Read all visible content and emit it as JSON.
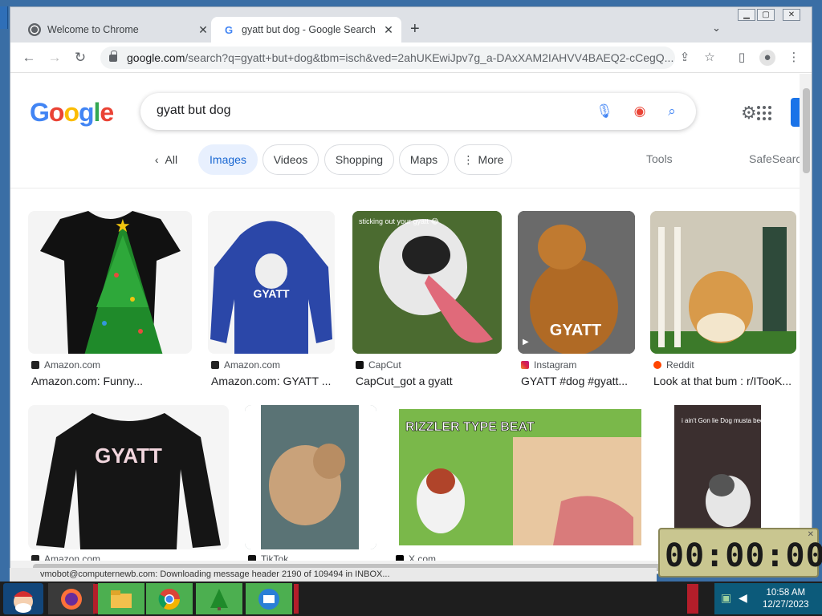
{
  "browser": {
    "tabs": [
      {
        "title": "Welcome to Chrome",
        "active": false
      },
      {
        "title": "gyatt but dog - Google Search",
        "active": true
      }
    ],
    "url_host": "google.com",
    "url_path": "/search?q=gyatt+but+dog&tbm=isch&ved=2ahUKEwiJpv7g_a-DAxXAM2IAHVV4BAEQ2-cCegQ..."
  },
  "google": {
    "logo": "Google",
    "query": "gyatt but dog",
    "chips": [
      "All",
      "Images",
      "Videos",
      "Shopping",
      "Maps",
      "More"
    ],
    "tools": "Tools",
    "safesearch": "SafeSearch"
  },
  "results": [
    {
      "source": "Amazon.com",
      "caption": "Amazon.com: Funny...",
      "thumb_text": ""
    },
    {
      "source": "Amazon.com",
      "caption": "Amazon.com: GYATT ...",
      "thumb_text": "GYATT"
    },
    {
      "source": "CapCut",
      "caption": "CapCut_got a gyatt",
      "thumb_text": "sticking out your gyatt 😂"
    },
    {
      "source": "Instagram",
      "caption": "GYATT #dog #gyatt...",
      "thumb_text": "GYATT"
    },
    {
      "source": "Reddit",
      "caption": "Look at that bum : r/ITooK...",
      "thumb_text": ""
    },
    {
      "source": "Amazon.com",
      "caption": "",
      "thumb_text": "GYATT"
    },
    {
      "source": "TikTok",
      "caption": "",
      "thumb_text": ""
    },
    {
      "source": "X.com",
      "caption": "",
      "thumb_text": "RIZZLER TYPE BEAT"
    },
    {
      "source": "",
      "caption": "",
      "thumb_text": "i ain't Gon lie  Dog musta been starvin😂"
    }
  ],
  "statusline": "vmobot@computernewb.com: Downloading message header 2190 of 109494 in INBOX...",
  "clock_widget": "00:00:00",
  "taskbar": {
    "time": "10:58 AM",
    "date": "12/27/2023"
  },
  "colors": {
    "google_blue": "#4285f4",
    "active_chip_bg": "#e8f0fe",
    "taskbar_bg": "#1e1e1e"
  }
}
